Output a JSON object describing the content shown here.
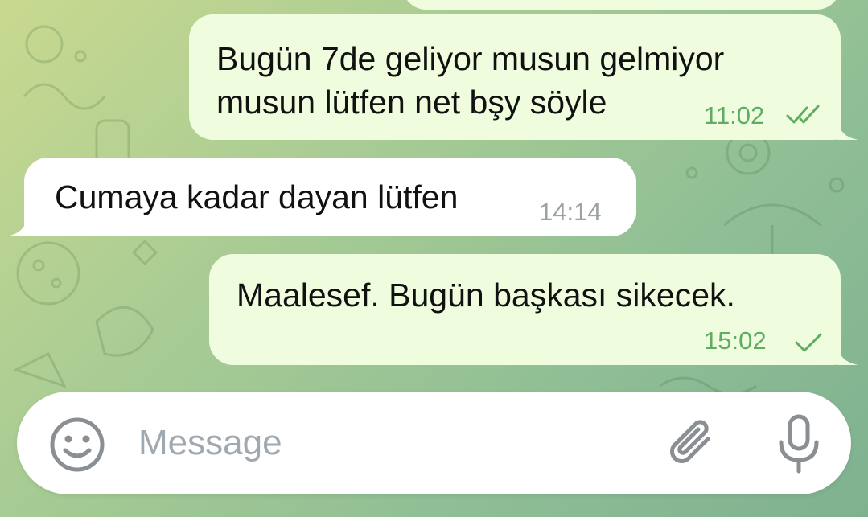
{
  "messages": [
    {
      "direction": "outgoing",
      "text": "Bugün 7de geliyor musun gelmiyor\nmusun lütfen net bşy söyle",
      "time": "11:02",
      "status": "read",
      "status_icon": "double-check-icon"
    },
    {
      "direction": "incoming",
      "text": "Cumaya kadar dayan lütfen",
      "time": "14:14"
    },
    {
      "direction": "outgoing",
      "text": "Maalesef. Bugün başkası sikecek.",
      "time": "15:02",
      "status": "sent",
      "status_icon": "single-check-icon"
    }
  ],
  "composer": {
    "placeholder": "Message",
    "emoji_icon": "smiley-icon",
    "attach_icon": "paperclip-icon",
    "mic_icon": "microphone-icon"
  },
  "colors": {
    "outgoing_bubble": "#effdde",
    "incoming_bubble": "#ffffff",
    "outgoing_meta": "#5fad63",
    "incoming_meta": "#9aa3a0",
    "icon_gray": "#8a8f94"
  }
}
